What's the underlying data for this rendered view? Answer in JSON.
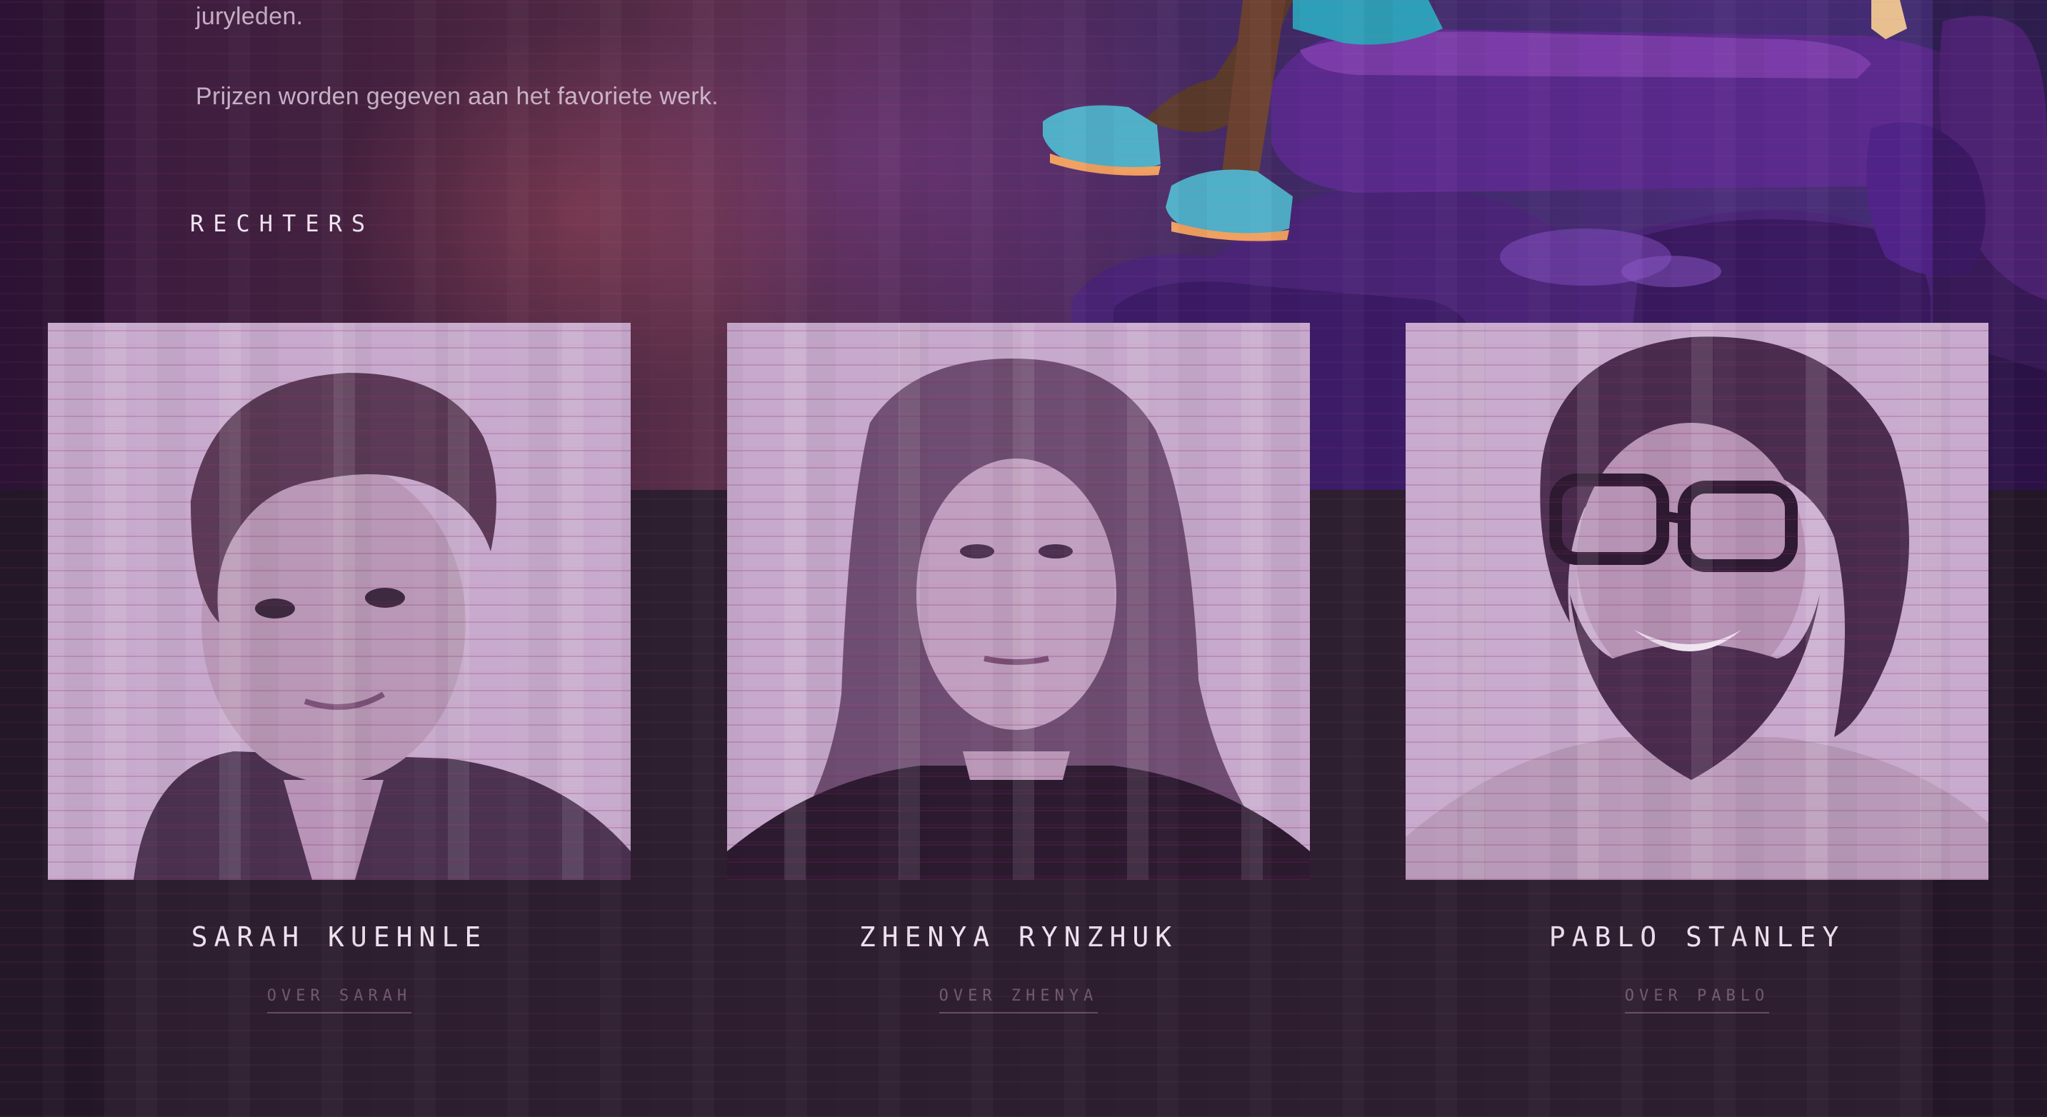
{
  "intro": {
    "line1": "juryleden.",
    "line2": "Prijzen worden gegeven aan het favoriete werk."
  },
  "judges_section": {
    "heading": "RECHTERS",
    "judges": [
      {
        "name": "SARAH KUEHNLE",
        "link": "OVER SARAH"
      },
      {
        "name": "ZHENYA RYNZHUK",
        "link": "OVER ZHENYA"
      },
      {
        "name": "PABLO STANLEY",
        "link": "OVER PABLO"
      }
    ]
  },
  "colors": {
    "background": "#2d1f2f",
    "hero_purple": "#4e2a5c",
    "photo_tint": "#c9adcf",
    "text_light": "#efe2f0",
    "link_muted": "#c8a0c8"
  }
}
